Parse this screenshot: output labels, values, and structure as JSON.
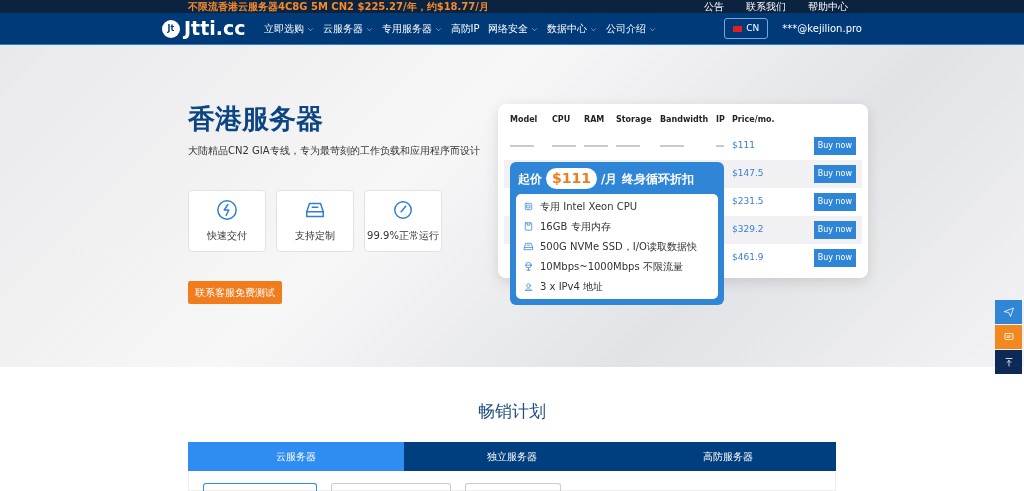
{
  "announcement": "不限流香港云服务器4C8G 5M CN2 $225.27/年，约$18.77/月",
  "top_links": [
    "公告",
    "联系我们",
    "帮助中心"
  ],
  "logo": {
    "mark": "Jt",
    "text": "Jtti.cc"
  },
  "nav": [
    {
      "label": "立即选购",
      "dropdown": true
    },
    {
      "label": "云服务器",
      "dropdown": true
    },
    {
      "label": "专用服务器",
      "dropdown": true
    },
    {
      "label": "高防IP",
      "dropdown": false
    },
    {
      "label": "网络安全",
      "dropdown": true
    },
    {
      "label": "数据中心",
      "dropdown": true
    },
    {
      "label": "公司介绍",
      "dropdown": true
    }
  ],
  "language": "CN",
  "account": "***@kejilion.pro",
  "hero": {
    "title": "香港服务器",
    "subtitle": "大陆精品CN2 GIA专线，专为最苛刻的工作负载和应用程序而设计",
    "features": [
      {
        "kind": "bolt",
        "label": "快速交付"
      },
      {
        "kind": "drive",
        "label": "支持定制"
      },
      {
        "kind": "gauge",
        "label": "99.9%正常运行"
      }
    ],
    "cta": "联系客服免费测试",
    "promo_table": {
      "columns": [
        "Model",
        "CPU",
        "RAM",
        "Storage",
        "Bandwidth",
        "IP",
        "Price/mo."
      ],
      "rows": [
        {
          "price": "$111",
          "button": "Buy now"
        },
        {
          "price": "$147.5",
          "button": "Buy now"
        },
        {
          "price": "$231.5",
          "button": "Buy now"
        },
        {
          "price": "$329.2",
          "button": "Buy now"
        },
        {
          "price": "$461.9",
          "button": "Buy now"
        }
      ]
    },
    "promo_card": {
      "prefix": "起价",
      "price": "$111",
      "suffix": "/月 终身循环折扣",
      "features": [
        {
          "kind": "chip",
          "text": "专用 Intel Xeon CPU"
        },
        {
          "kind": "memory",
          "text": "16GB 专用内存"
        },
        {
          "kind": "drive",
          "text": "500G NVMe SSD，I/O读取数据快"
        },
        {
          "kind": "globe",
          "text": "10Mbps~1000Mbps 不限流量"
        },
        {
          "kind": "location",
          "text": "3 x IPv4 地址"
        }
      ]
    }
  },
  "side_buttons": [
    {
      "kind": "send"
    },
    {
      "kind": "chat"
    },
    {
      "kind": "top"
    }
  ],
  "plans": {
    "title": "畅销计划",
    "tabs": [
      {
        "label": "云服务器",
        "selected": true
      },
      {
        "label": "独立服务器",
        "selected": false
      },
      {
        "label": "高防服务器",
        "selected": false
      }
    ]
  }
}
